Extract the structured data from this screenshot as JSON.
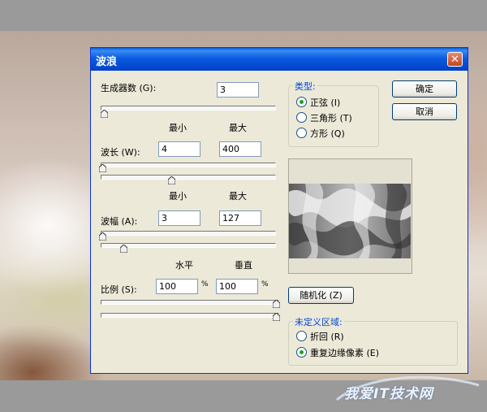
{
  "dialog": {
    "title": "波浪",
    "close_glyph": "✕",
    "generators": {
      "label": "生成器数 (G):",
      "value": "3"
    },
    "col_min": "最小",
    "col_max": "最大",
    "wavelength": {
      "label": "波长 (W):",
      "min": "4",
      "max": "400"
    },
    "amplitude": {
      "label": "波幅 (A):",
      "min": "3",
      "max": "127"
    },
    "col_horizontal": "水平",
    "col_vertical": "垂直",
    "scale": {
      "label": "比例 (S):",
      "horizontal": "100",
      "vertical": "100",
      "unit": "%"
    },
    "type_group": {
      "title": "类型:",
      "options": [
        "正弦 (I)",
        "三角形 (T)",
        "方形 (Q)"
      ],
      "selected": "正弦 (I)"
    },
    "ok_label": "确定",
    "cancel_label": "取消",
    "randomize_label": "随机化 (Z)",
    "undefined_group": {
      "title": "未定义区域:",
      "options": [
        "折回 (R)",
        "重复边缘像素 (E)"
      ],
      "selected": "重复边缘像素 (E)"
    },
    "icons": {
      "close": "close-icon",
      "wave_preview": "wave-preview-image"
    }
  },
  "watermark": {
    "text": "我爱IT技术网"
  }
}
